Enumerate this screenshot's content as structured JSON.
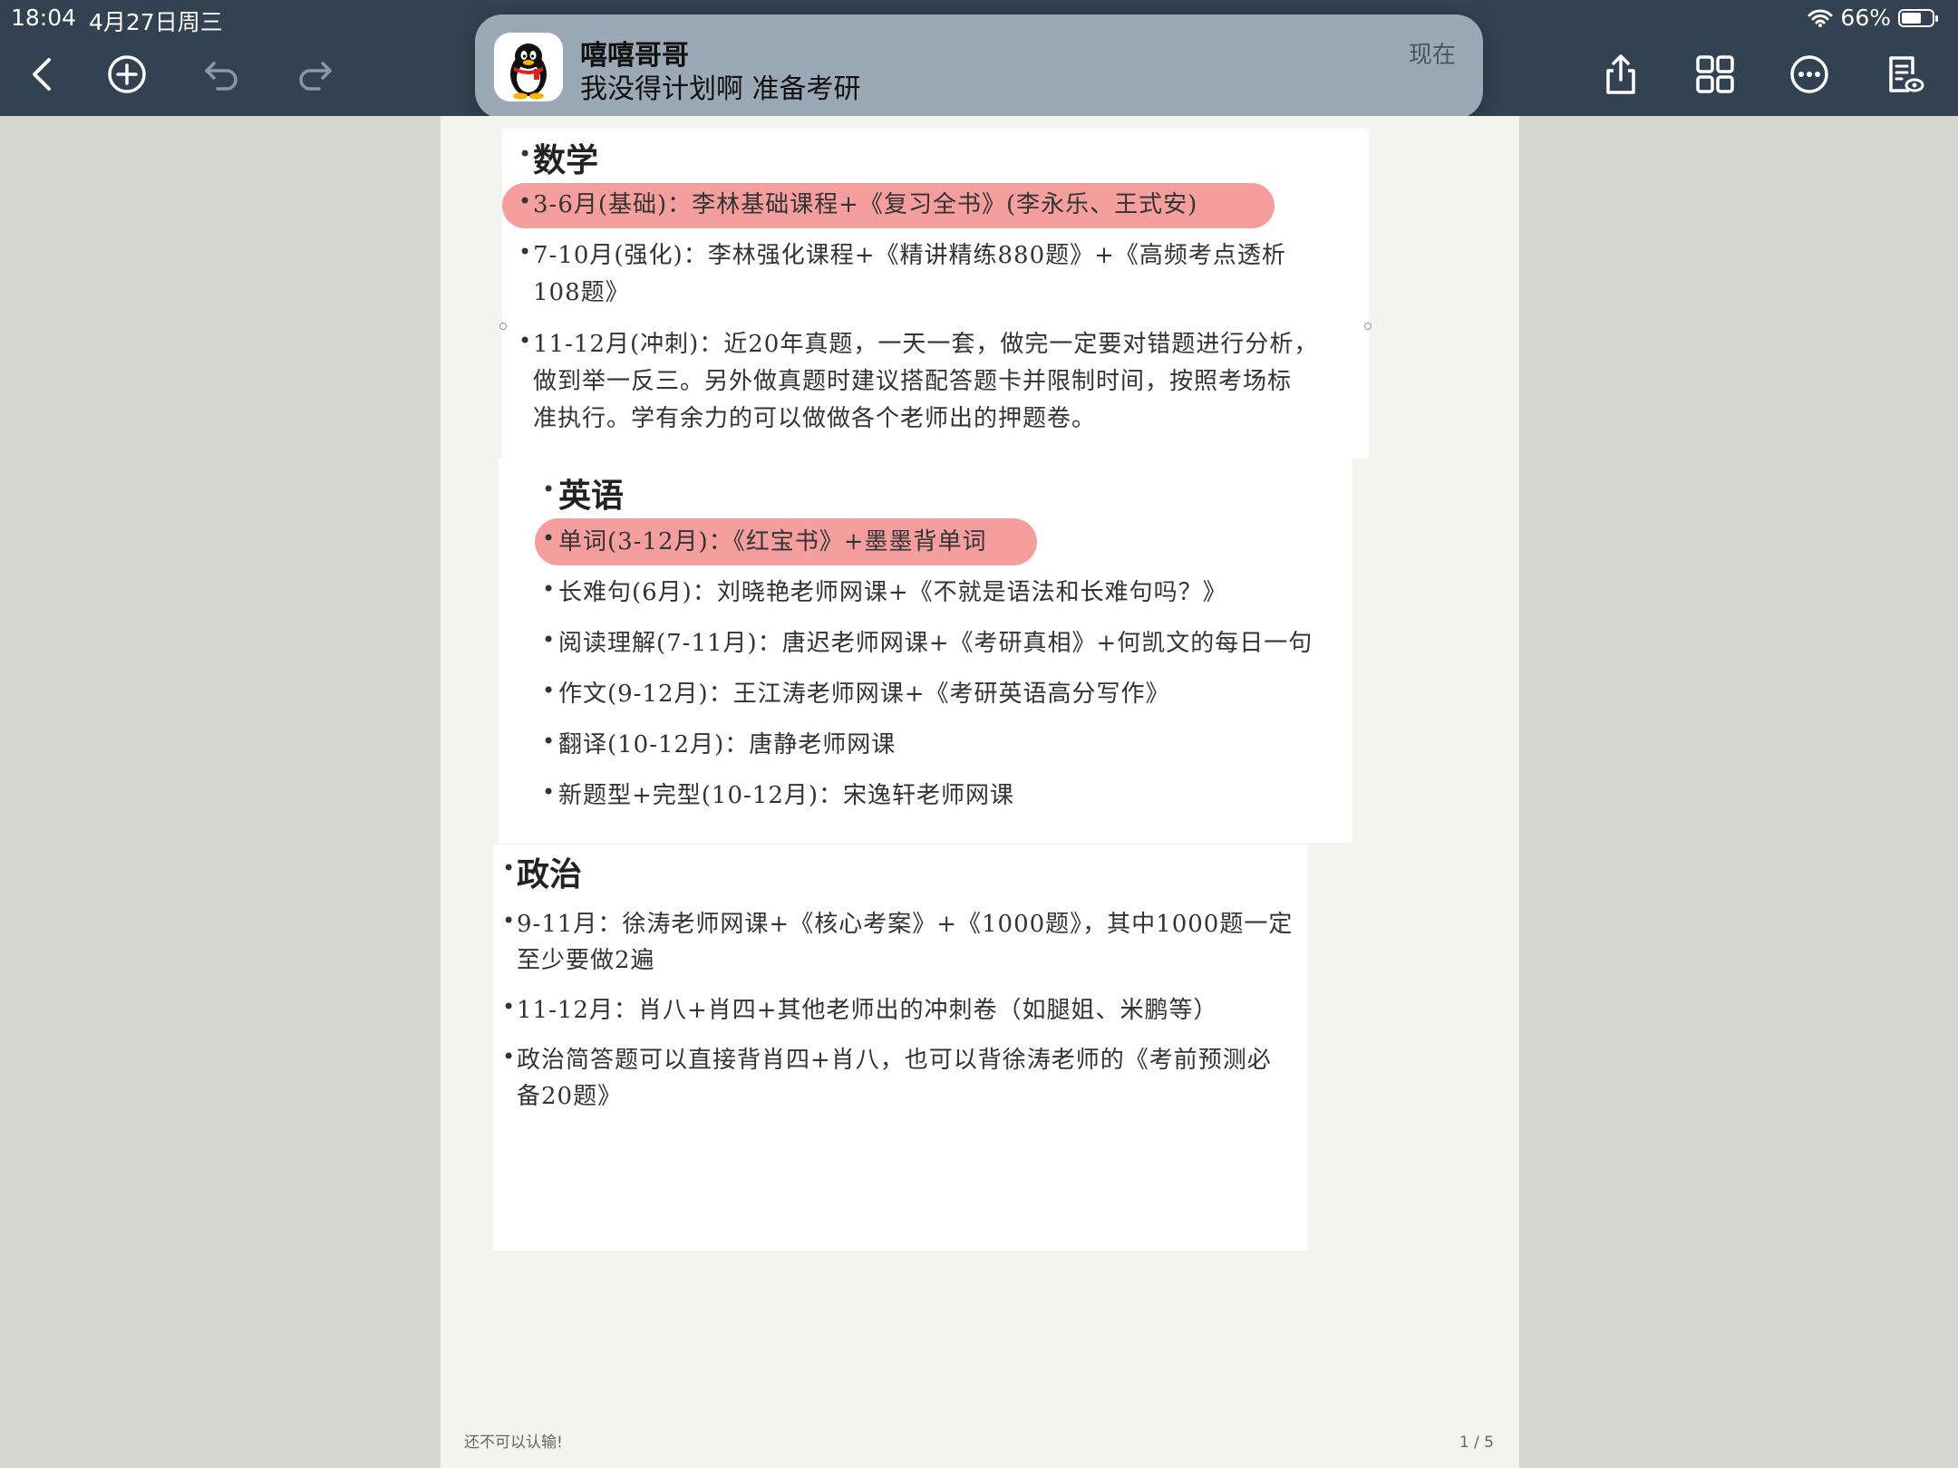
{
  "status_bar": {
    "time": "18:04",
    "date": "4月27日周三",
    "battery": "66%",
    "battery_level": 0.66
  },
  "toolbar": {
    "icons": [
      "back-icon",
      "add-icon",
      "undo-icon",
      "redo-icon",
      "share-icon",
      "grid-icon",
      "more-icon",
      "reader-icon"
    ]
  },
  "notification": {
    "app_icon": "qq-penguin-icon",
    "title": "嘻嘻哥哥",
    "message": "我没得计划啊 准备考研",
    "time": "现在"
  },
  "document": {
    "sections": {
      "math": {
        "title": "数学",
        "items": [
          "3-6月(基础)：李林基础课程+《复习全书》(李永乐、王式安)",
          "7-10月(强化)：李林强化课程+《精讲精练880题》+《高频考点透析",
          "108题》",
          "11-12月(冲刺)：近20年真题，一天一套，做完一定要对错题进行分析，",
          "做到举一反三。另外做真题时建议搭配答题卡并限制时间，按照考场标",
          "准执行。学有余力的可以做做各个老师出的押题卷。"
        ]
      },
      "english": {
        "title": "英语",
        "items": [
          "单词(3-12月)：《红宝书》+墨墨背单词",
          "长难句(6月)：刘晓艳老师网课+《不就是语法和长难句吗？》",
          "阅读理解(7-11月)：唐迟老师网课+《考研真相》+何凯文的每日一句",
          "作文(9-12月)：王江涛老师网课+《考研英语高分写作》",
          "翻译(10-12月)：唐静老师网课",
          "新题型+完型(10-12月)：宋逸轩老师网课"
        ]
      },
      "politics": {
        "title": "政治",
        "items": [
          "9-11月：徐涛老师网课+《核心考案》+《1000题》，其中1000题一定",
          "至少要做2遍",
          "11-12月：肖八+肖四+其他老师出的冲刺卷（如腿姐、米鹏等）",
          "政治简答题可以直接背肖四+肖八，也可以背徐涛老师的《考前预测必",
          "备20题》"
        ]
      }
    },
    "highlight_color": "#f07878",
    "footer_note": "还不可以认输!",
    "page_indicator": "1 / 5"
  }
}
